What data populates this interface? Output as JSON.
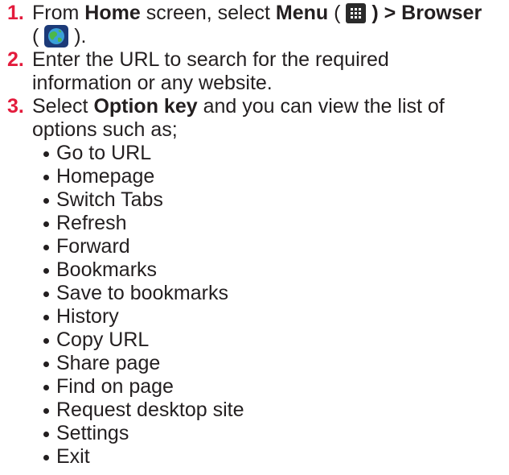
{
  "steps": [
    {
      "number": "1.",
      "prefix": "From ",
      "home": "Home",
      "mid": " screen, select ",
      "menu": "Menu",
      "open_paren": " ( ",
      "menu_icon": "menu-grid-icon",
      "close_sep": " ) > ",
      "browser": "Browser",
      "open_paren2": "( ",
      "browser_icon": "browser-globe-icon",
      "close_end": " )."
    },
    {
      "number": "2.",
      "line1": "Enter the URL to search for the required",
      "line2": "information or any website."
    },
    {
      "number": "3.",
      "prefix": "Select ",
      "option_key": "Option key",
      "suffix1": " and you can view the list of",
      "line2": "options such as;",
      "options": [
        "Go to URL",
        "Homepage",
        "Switch Tabs",
        "Refresh",
        "Forward",
        "Bookmarks",
        "Save to bookmarks",
        "History",
        "Copy URL",
        "Share page",
        "Find on page",
        "Request desktop site",
        "Settings",
        "Exit"
      ]
    }
  ],
  "colors": {
    "accent": "#e31b3c",
    "text": "#231f20"
  }
}
